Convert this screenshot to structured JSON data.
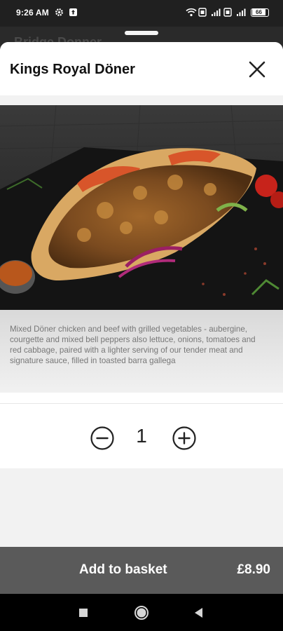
{
  "status_bar": {
    "time": "9:26 AM",
    "left_icons": [
      "gear-icon",
      "upload-icon"
    ],
    "right_icons": [
      "wifi-icon",
      "sim-icon",
      "signal-icon",
      "sim-icon",
      "signal-icon",
      "battery-icon"
    ],
    "battery": "66"
  },
  "background": {
    "title": "Bridge Donner"
  },
  "sheet": {
    "title": "Kings Royal Döner",
    "close_icon": "close-icon",
    "description": "Mixed Döner chicken and beef with grilled vegetables - aubergine, courgette and mixed bell peppers also lettuce, onions, tomatoes and red cabbage, paired with a lighter serving of our tender meat and signature sauce, filled in toasted barra gallega",
    "quantity": "1",
    "add_button_label": "Add to basket",
    "price": "£8.90"
  },
  "colors": {
    "basket_bar": "#5a5a5a",
    "band": "#f2f2f2",
    "text_muted": "#777777"
  },
  "nav_bar": {
    "buttons": [
      "recents-icon",
      "home-icon",
      "back-icon"
    ]
  }
}
